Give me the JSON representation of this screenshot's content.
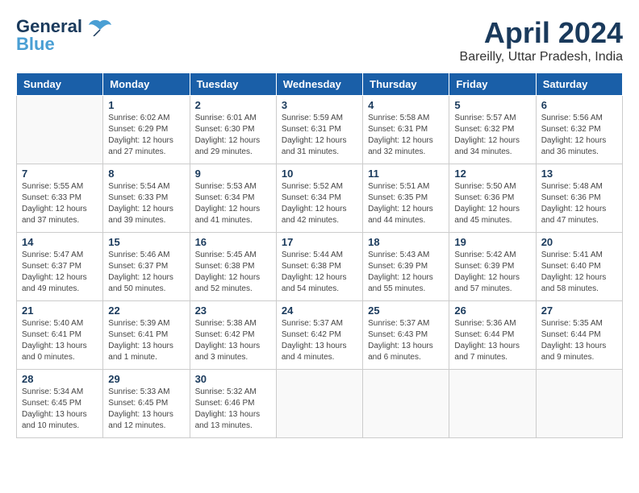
{
  "header": {
    "logo_line1": "General",
    "logo_line2": "Blue",
    "main_title": "April 2024",
    "subtitle": "Bareilly, Uttar Pradesh, India"
  },
  "days_of_week": [
    "Sunday",
    "Monday",
    "Tuesday",
    "Wednesday",
    "Thursday",
    "Friday",
    "Saturday"
  ],
  "weeks": [
    [
      {
        "day": "",
        "info": ""
      },
      {
        "day": "1",
        "info": "Sunrise: 6:02 AM\nSunset: 6:29 PM\nDaylight: 12 hours\nand 27 minutes."
      },
      {
        "day": "2",
        "info": "Sunrise: 6:01 AM\nSunset: 6:30 PM\nDaylight: 12 hours\nand 29 minutes."
      },
      {
        "day": "3",
        "info": "Sunrise: 5:59 AM\nSunset: 6:31 PM\nDaylight: 12 hours\nand 31 minutes."
      },
      {
        "day": "4",
        "info": "Sunrise: 5:58 AM\nSunset: 6:31 PM\nDaylight: 12 hours\nand 32 minutes."
      },
      {
        "day": "5",
        "info": "Sunrise: 5:57 AM\nSunset: 6:32 PM\nDaylight: 12 hours\nand 34 minutes."
      },
      {
        "day": "6",
        "info": "Sunrise: 5:56 AM\nSunset: 6:32 PM\nDaylight: 12 hours\nand 36 minutes."
      }
    ],
    [
      {
        "day": "7",
        "info": "Sunrise: 5:55 AM\nSunset: 6:33 PM\nDaylight: 12 hours\nand 37 minutes."
      },
      {
        "day": "8",
        "info": "Sunrise: 5:54 AM\nSunset: 6:33 PM\nDaylight: 12 hours\nand 39 minutes."
      },
      {
        "day": "9",
        "info": "Sunrise: 5:53 AM\nSunset: 6:34 PM\nDaylight: 12 hours\nand 41 minutes."
      },
      {
        "day": "10",
        "info": "Sunrise: 5:52 AM\nSunset: 6:34 PM\nDaylight: 12 hours\nand 42 minutes."
      },
      {
        "day": "11",
        "info": "Sunrise: 5:51 AM\nSunset: 6:35 PM\nDaylight: 12 hours\nand 44 minutes."
      },
      {
        "day": "12",
        "info": "Sunrise: 5:50 AM\nSunset: 6:36 PM\nDaylight: 12 hours\nand 45 minutes."
      },
      {
        "day": "13",
        "info": "Sunrise: 5:48 AM\nSunset: 6:36 PM\nDaylight: 12 hours\nand 47 minutes."
      }
    ],
    [
      {
        "day": "14",
        "info": "Sunrise: 5:47 AM\nSunset: 6:37 PM\nDaylight: 12 hours\nand 49 minutes."
      },
      {
        "day": "15",
        "info": "Sunrise: 5:46 AM\nSunset: 6:37 PM\nDaylight: 12 hours\nand 50 minutes."
      },
      {
        "day": "16",
        "info": "Sunrise: 5:45 AM\nSunset: 6:38 PM\nDaylight: 12 hours\nand 52 minutes."
      },
      {
        "day": "17",
        "info": "Sunrise: 5:44 AM\nSunset: 6:38 PM\nDaylight: 12 hours\nand 54 minutes."
      },
      {
        "day": "18",
        "info": "Sunrise: 5:43 AM\nSunset: 6:39 PM\nDaylight: 12 hours\nand 55 minutes."
      },
      {
        "day": "19",
        "info": "Sunrise: 5:42 AM\nSunset: 6:39 PM\nDaylight: 12 hours\nand 57 minutes."
      },
      {
        "day": "20",
        "info": "Sunrise: 5:41 AM\nSunset: 6:40 PM\nDaylight: 12 hours\nand 58 minutes."
      }
    ],
    [
      {
        "day": "21",
        "info": "Sunrise: 5:40 AM\nSunset: 6:41 PM\nDaylight: 13 hours\nand 0 minutes."
      },
      {
        "day": "22",
        "info": "Sunrise: 5:39 AM\nSunset: 6:41 PM\nDaylight: 13 hours\nand 1 minute."
      },
      {
        "day": "23",
        "info": "Sunrise: 5:38 AM\nSunset: 6:42 PM\nDaylight: 13 hours\nand 3 minutes."
      },
      {
        "day": "24",
        "info": "Sunrise: 5:37 AM\nSunset: 6:42 PM\nDaylight: 13 hours\nand 4 minutes."
      },
      {
        "day": "25",
        "info": "Sunrise: 5:37 AM\nSunset: 6:43 PM\nDaylight: 13 hours\nand 6 minutes."
      },
      {
        "day": "26",
        "info": "Sunrise: 5:36 AM\nSunset: 6:44 PM\nDaylight: 13 hours\nand 7 minutes."
      },
      {
        "day": "27",
        "info": "Sunrise: 5:35 AM\nSunset: 6:44 PM\nDaylight: 13 hours\nand 9 minutes."
      }
    ],
    [
      {
        "day": "28",
        "info": "Sunrise: 5:34 AM\nSunset: 6:45 PM\nDaylight: 13 hours\nand 10 minutes."
      },
      {
        "day": "29",
        "info": "Sunrise: 5:33 AM\nSunset: 6:45 PM\nDaylight: 13 hours\nand 12 minutes."
      },
      {
        "day": "30",
        "info": "Sunrise: 5:32 AM\nSunset: 6:46 PM\nDaylight: 13 hours\nand 13 minutes."
      },
      {
        "day": "",
        "info": ""
      },
      {
        "day": "",
        "info": ""
      },
      {
        "day": "",
        "info": ""
      },
      {
        "day": "",
        "info": ""
      }
    ]
  ]
}
